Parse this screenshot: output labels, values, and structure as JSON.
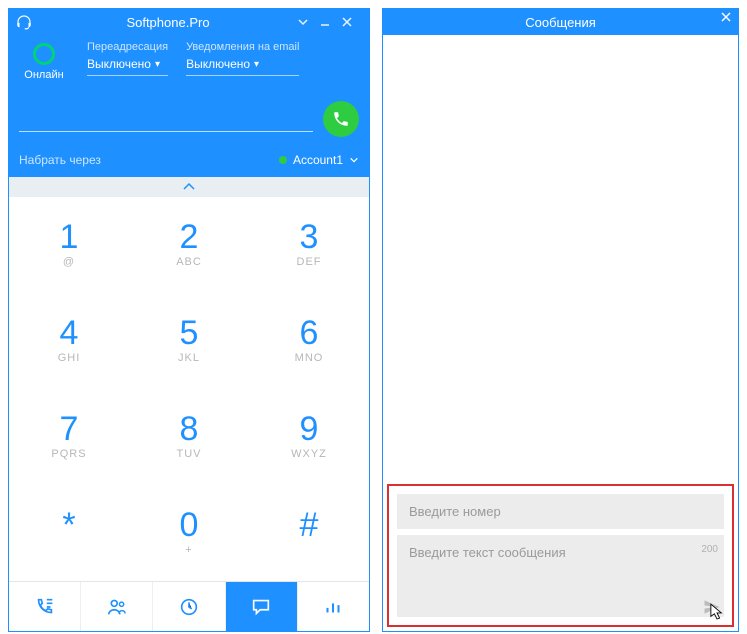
{
  "main": {
    "title": "Softphone.Pro",
    "status": {
      "label": "Онлайн"
    },
    "forwarding": {
      "caption": "Переадресация",
      "value": "Выключено"
    },
    "notifications": {
      "caption": "Уведомления на email",
      "value": "Выключено"
    },
    "dial_through": "Набрать через",
    "account": {
      "name": "Account1"
    },
    "keypad": [
      {
        "digit": "1",
        "letters": "@"
      },
      {
        "digit": "2",
        "letters": "ABC"
      },
      {
        "digit": "3",
        "letters": "DEF"
      },
      {
        "digit": "4",
        "letters": "GHI"
      },
      {
        "digit": "5",
        "letters": "JKL"
      },
      {
        "digit": "6",
        "letters": "MNO"
      },
      {
        "digit": "7",
        "letters": "PQRS"
      },
      {
        "digit": "8",
        "letters": "TUV"
      },
      {
        "digit": "9",
        "letters": "WXYZ"
      },
      {
        "digit": "*",
        "letters": ""
      },
      {
        "digit": "0",
        "letters": "+"
      },
      {
        "digit": "#",
        "letters": ""
      }
    ]
  },
  "messages": {
    "title": "Сообщения",
    "number_placeholder": "Введите номер",
    "text_placeholder": "Введите текст сообщения",
    "char_count": "200"
  }
}
